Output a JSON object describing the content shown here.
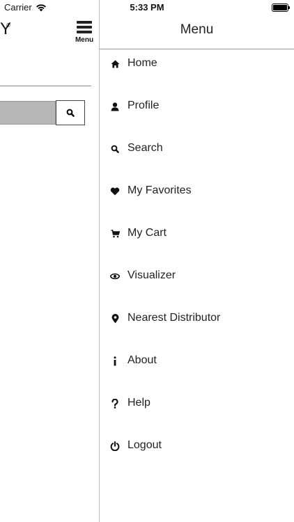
{
  "status_bar": {
    "carrier": "Carrier",
    "time": "5:33 PM"
  },
  "left_pane": {
    "logo_fragment": "Y",
    "registered_mark": "®",
    "menu_button_label": "Menu"
  },
  "menu": {
    "title": "Menu",
    "items": [
      {
        "label": "Home",
        "icon": "home-icon"
      },
      {
        "label": "Profile",
        "icon": "person-icon"
      },
      {
        "label": "Search",
        "icon": "search-icon"
      },
      {
        "label": "My Favorites",
        "icon": "heart-icon"
      },
      {
        "label": "My Cart",
        "icon": "cart-icon"
      },
      {
        "label": "Visualizer",
        "icon": "eye-icon"
      },
      {
        "label": "Nearest Distributor",
        "icon": "map-pin-icon"
      },
      {
        "label": "About",
        "icon": "info-icon"
      },
      {
        "label": "Help",
        "icon": "question-icon"
      },
      {
        "label": "Logout",
        "icon": "power-icon"
      }
    ]
  }
}
